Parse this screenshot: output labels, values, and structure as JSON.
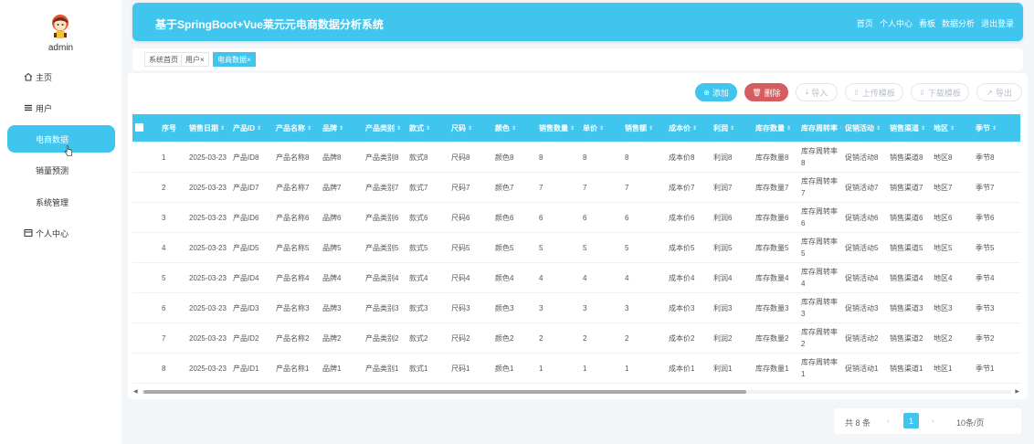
{
  "user": {
    "name": "admin"
  },
  "sidebar": {
    "items": [
      {
        "label": "主页",
        "icon": "home-icon"
      },
      {
        "label": "用户",
        "icon": "list-icon"
      },
      {
        "label": "电商数据",
        "icon": "grid-icon",
        "active": true
      },
      {
        "label": "销量预测",
        "icon": "grid-icon"
      },
      {
        "label": "系统管理",
        "icon": "grid-icon"
      },
      {
        "label": "个人中心",
        "icon": "card-icon"
      }
    ]
  },
  "header": {
    "title": "基于SpringBoot+Vue莱元元电商数据分析系统",
    "nav": [
      "首页",
      "个人中心",
      "看板",
      "数据分析",
      "退出登录"
    ]
  },
  "tabs": [
    {
      "label": "系统首页",
      "closable": false
    },
    {
      "label": "用户",
      "closable": true
    },
    {
      "label": "电商数据",
      "closable": true,
      "active": true
    }
  ],
  "toolbar": {
    "add": "添加",
    "delete": "删除",
    "import": "导入",
    "upload_template": "上传模板",
    "download_template": "下载模板",
    "export": "导出"
  },
  "table": {
    "columns": [
      "序号",
      "销售日期",
      "产品ID",
      "产品名称",
      "品牌",
      "产品类别",
      "款式",
      "尺码",
      "颜色",
      "销售数量",
      "单价",
      "销售额",
      "成本价",
      "利润",
      "库存数量",
      "库存周转率",
      "促销活动",
      "销售渠道",
      "地区",
      "季节"
    ],
    "rows": [
      [
        "1",
        "2025-03-23",
        "产品ID8",
        "产品名称8",
        "品牌8",
        "产品类别8",
        "款式8",
        "尺码8",
        "颜色8",
        "8",
        "8",
        "8",
        "成本价8",
        "利润8",
        "库存数量8",
        "库存周转率8",
        "促销活动8",
        "销售渠道8",
        "地区8",
        "季节8"
      ],
      [
        "2",
        "2025-03-23",
        "产品ID7",
        "产品名称7",
        "品牌7",
        "产品类别7",
        "款式7",
        "尺码7",
        "颜色7",
        "7",
        "7",
        "7",
        "成本价7",
        "利润7",
        "库存数量7",
        "库存周转率7",
        "促销活动7",
        "销售渠道7",
        "地区7",
        "季节7"
      ],
      [
        "3",
        "2025-03-23",
        "产品ID6",
        "产品名称6",
        "品牌6",
        "产品类别6",
        "款式6",
        "尺码6",
        "颜色6",
        "6",
        "6",
        "6",
        "成本价6",
        "利润6",
        "库存数量6",
        "库存周转率6",
        "促销活动6",
        "销售渠道6",
        "地区6",
        "季节6"
      ],
      [
        "4",
        "2025-03-23",
        "产品ID5",
        "产品名称5",
        "品牌5",
        "产品类别5",
        "款式5",
        "尺码5",
        "颜色5",
        "5",
        "5",
        "5",
        "成本价5",
        "利润5",
        "库存数量5",
        "库存周转率5",
        "促销活动5",
        "销售渠道5",
        "地区5",
        "季节5"
      ],
      [
        "5",
        "2025-03-23",
        "产品ID4",
        "产品名称4",
        "品牌4",
        "产品类别4",
        "款式4",
        "尺码4",
        "颜色4",
        "4",
        "4",
        "4",
        "成本价4",
        "利润4",
        "库存数量4",
        "库存周转率4",
        "促销活动4",
        "销售渠道4",
        "地区4",
        "季节4"
      ],
      [
        "6",
        "2025-03-23",
        "产品ID3",
        "产品名称3",
        "品牌3",
        "产品类别3",
        "款式3",
        "尺码3",
        "颜色3",
        "3",
        "3",
        "3",
        "成本价3",
        "利润3",
        "库存数量3",
        "库存周转率3",
        "促销活动3",
        "销售渠道3",
        "地区3",
        "季节3"
      ],
      [
        "7",
        "2025-03-23",
        "产品ID2",
        "产品名称2",
        "品牌2",
        "产品类别2",
        "款式2",
        "尺码2",
        "颜色2",
        "2",
        "2",
        "2",
        "成本价2",
        "利润2",
        "库存数量2",
        "库存周转率2",
        "促销活动2",
        "销售渠道2",
        "地区2",
        "季节2"
      ],
      [
        "8",
        "2025-03-23",
        "产品ID1",
        "产品名称1",
        "品牌1",
        "产品类别1",
        "款式1",
        "尺码1",
        "颜色1",
        "1",
        "1",
        "1",
        "成本价1",
        "利润1",
        "库存数量1",
        "库存周转率1",
        "促销活动1",
        "销售渠道1",
        "地区1",
        "季节1"
      ]
    ]
  },
  "pagination": {
    "total": "共 8 条",
    "current": "1",
    "page_size": "10条/页"
  },
  "colors": {
    "primary": "#3fc5ee",
    "danger": "#d55d5f",
    "background": "#f3f6f9"
  }
}
